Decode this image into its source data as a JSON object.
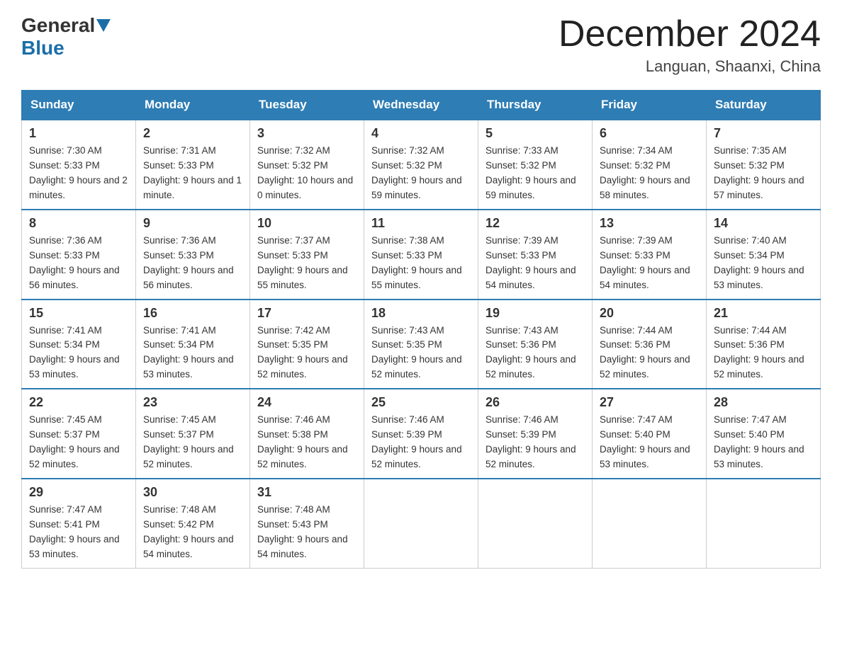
{
  "logo": {
    "general": "General",
    "blue": "Blue"
  },
  "header": {
    "month": "December 2024",
    "location": "Languan, Shaanxi, China"
  },
  "days_of_week": [
    "Sunday",
    "Monday",
    "Tuesday",
    "Wednesday",
    "Thursday",
    "Friday",
    "Saturday"
  ],
  "weeks": [
    [
      {
        "day": "1",
        "sunrise": "7:30 AM",
        "sunset": "5:33 PM",
        "daylight": "9 hours and 2 minutes."
      },
      {
        "day": "2",
        "sunrise": "7:31 AM",
        "sunset": "5:33 PM",
        "daylight": "9 hours and 1 minute."
      },
      {
        "day": "3",
        "sunrise": "7:32 AM",
        "sunset": "5:32 PM",
        "daylight": "10 hours and 0 minutes."
      },
      {
        "day": "4",
        "sunrise": "7:32 AM",
        "sunset": "5:32 PM",
        "daylight": "9 hours and 59 minutes."
      },
      {
        "day": "5",
        "sunrise": "7:33 AM",
        "sunset": "5:32 PM",
        "daylight": "9 hours and 59 minutes."
      },
      {
        "day": "6",
        "sunrise": "7:34 AM",
        "sunset": "5:32 PM",
        "daylight": "9 hours and 58 minutes."
      },
      {
        "day": "7",
        "sunrise": "7:35 AM",
        "sunset": "5:32 PM",
        "daylight": "9 hours and 57 minutes."
      }
    ],
    [
      {
        "day": "8",
        "sunrise": "7:36 AM",
        "sunset": "5:33 PM",
        "daylight": "9 hours and 56 minutes."
      },
      {
        "day": "9",
        "sunrise": "7:36 AM",
        "sunset": "5:33 PM",
        "daylight": "9 hours and 56 minutes."
      },
      {
        "day": "10",
        "sunrise": "7:37 AM",
        "sunset": "5:33 PM",
        "daylight": "9 hours and 55 minutes."
      },
      {
        "day": "11",
        "sunrise": "7:38 AM",
        "sunset": "5:33 PM",
        "daylight": "9 hours and 55 minutes."
      },
      {
        "day": "12",
        "sunrise": "7:39 AM",
        "sunset": "5:33 PM",
        "daylight": "9 hours and 54 minutes."
      },
      {
        "day": "13",
        "sunrise": "7:39 AM",
        "sunset": "5:33 PM",
        "daylight": "9 hours and 54 minutes."
      },
      {
        "day": "14",
        "sunrise": "7:40 AM",
        "sunset": "5:34 PM",
        "daylight": "9 hours and 53 minutes."
      }
    ],
    [
      {
        "day": "15",
        "sunrise": "7:41 AM",
        "sunset": "5:34 PM",
        "daylight": "9 hours and 53 minutes."
      },
      {
        "day": "16",
        "sunrise": "7:41 AM",
        "sunset": "5:34 PM",
        "daylight": "9 hours and 53 minutes."
      },
      {
        "day": "17",
        "sunrise": "7:42 AM",
        "sunset": "5:35 PM",
        "daylight": "9 hours and 52 minutes."
      },
      {
        "day": "18",
        "sunrise": "7:43 AM",
        "sunset": "5:35 PM",
        "daylight": "9 hours and 52 minutes."
      },
      {
        "day": "19",
        "sunrise": "7:43 AM",
        "sunset": "5:36 PM",
        "daylight": "9 hours and 52 minutes."
      },
      {
        "day": "20",
        "sunrise": "7:44 AM",
        "sunset": "5:36 PM",
        "daylight": "9 hours and 52 minutes."
      },
      {
        "day": "21",
        "sunrise": "7:44 AM",
        "sunset": "5:36 PM",
        "daylight": "9 hours and 52 minutes."
      }
    ],
    [
      {
        "day": "22",
        "sunrise": "7:45 AM",
        "sunset": "5:37 PM",
        "daylight": "9 hours and 52 minutes."
      },
      {
        "day": "23",
        "sunrise": "7:45 AM",
        "sunset": "5:37 PM",
        "daylight": "9 hours and 52 minutes."
      },
      {
        "day": "24",
        "sunrise": "7:46 AM",
        "sunset": "5:38 PM",
        "daylight": "9 hours and 52 minutes."
      },
      {
        "day": "25",
        "sunrise": "7:46 AM",
        "sunset": "5:39 PM",
        "daylight": "9 hours and 52 minutes."
      },
      {
        "day": "26",
        "sunrise": "7:46 AM",
        "sunset": "5:39 PM",
        "daylight": "9 hours and 52 minutes."
      },
      {
        "day": "27",
        "sunrise": "7:47 AM",
        "sunset": "5:40 PM",
        "daylight": "9 hours and 53 minutes."
      },
      {
        "day": "28",
        "sunrise": "7:47 AM",
        "sunset": "5:40 PM",
        "daylight": "9 hours and 53 minutes."
      }
    ],
    [
      {
        "day": "29",
        "sunrise": "7:47 AM",
        "sunset": "5:41 PM",
        "daylight": "9 hours and 53 minutes."
      },
      {
        "day": "30",
        "sunrise": "7:48 AM",
        "sunset": "5:42 PM",
        "daylight": "9 hours and 54 minutes."
      },
      {
        "day": "31",
        "sunrise": "7:48 AM",
        "sunset": "5:43 PM",
        "daylight": "9 hours and 54 minutes."
      },
      null,
      null,
      null,
      null
    ]
  ],
  "labels": {
    "sunrise": "Sunrise:",
    "sunset": "Sunset:",
    "daylight": "Daylight:"
  }
}
